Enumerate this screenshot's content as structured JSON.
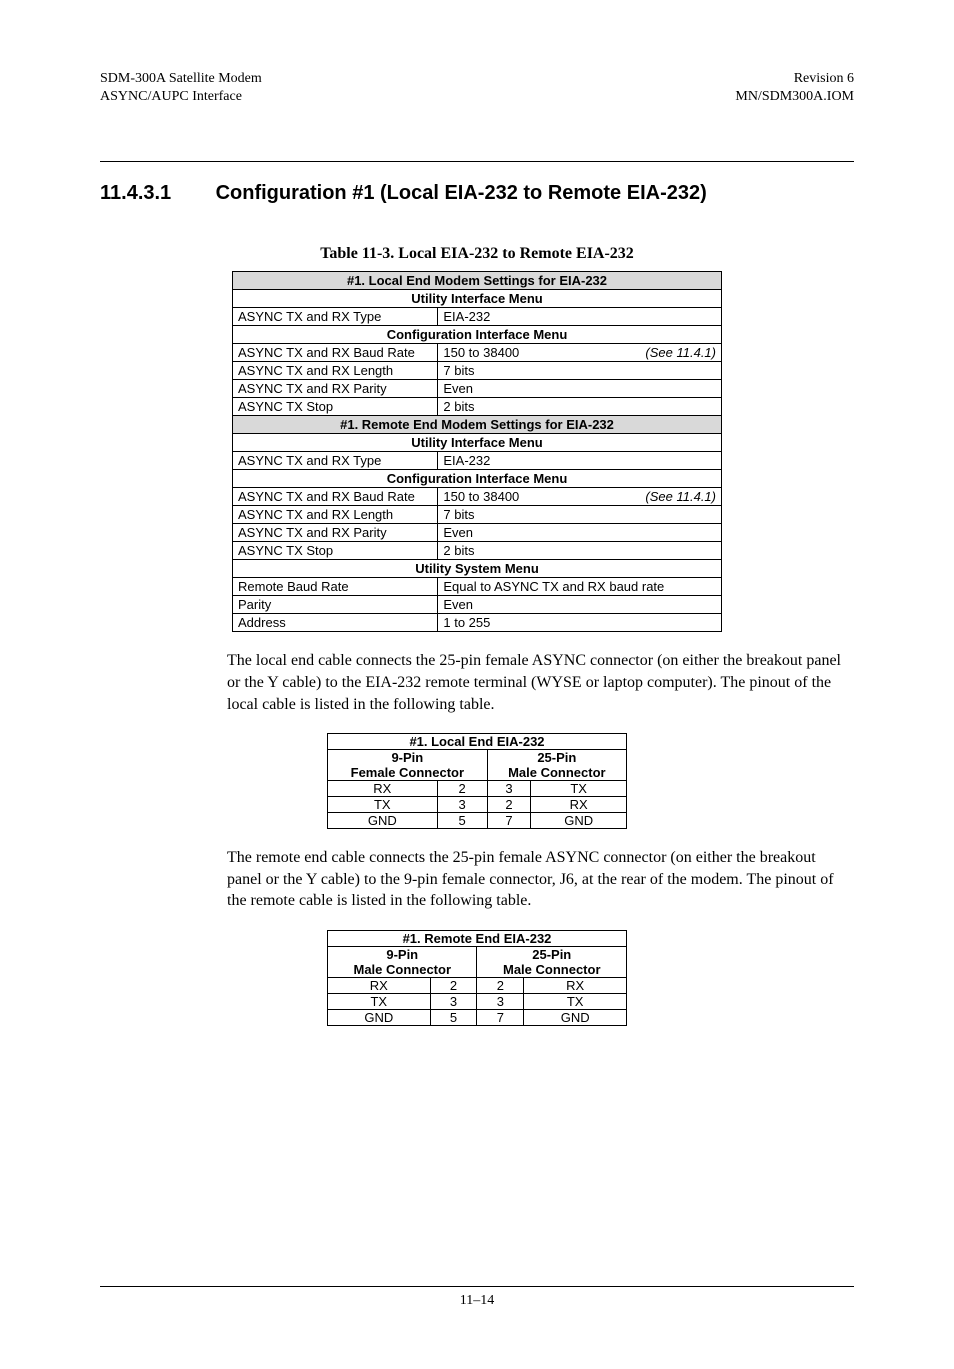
{
  "header": {
    "left1": "SDM-300A Satellite Modem",
    "left2": "ASYNC/AUPC Interface",
    "right1": "Revision 6",
    "right2": "MN/SDM300A.IOM"
  },
  "section": {
    "number": "11.4.3.1",
    "title": "Configuration #1 (Local EIA-232 to Remote EIA-232)"
  },
  "table_caption": "Table 11-3.  Local EIA-232 to Remote EIA-232",
  "settings_table": {
    "title1": "#1. Local End Modem Settings for EIA-232",
    "menu_util": "Utility Interface Menu",
    "row_type_label": "ASYNC TX and RX Type",
    "row_type_val": "EIA-232",
    "menu_conf": "Configuration Interface Menu",
    "row_baud_label": "ASYNC TX and RX Baud Rate",
    "row_baud_val": "150 to 38400",
    "row_baud_note": "(See 11.4.1)",
    "row_len_label": "ASYNC TX and RX Length",
    "row_len_val": "7 bits",
    "row_par_label": "ASYNC TX and RX Parity",
    "row_par_val": "Even",
    "row_stop_label": "ASYNC TX Stop",
    "row_stop_val": "2 bits",
    "title2": "#1. Remote End Modem Settings for EIA-232",
    "menu_sys": "Utility System Menu",
    "row_rbaud_label": "Remote Baud Rate",
    "row_rbaud_val": "Equal to ASYNC TX and RX baud rate",
    "row_rpar_label": "Parity",
    "row_rpar_val": "Even",
    "row_addr_label": "Address",
    "row_addr_val": "1 to 255"
  },
  "para1": "The local end cable connects the 25-pin female ASYNC connector (on either the breakout panel or the Y cable) to the EIA-232 remote terminal (WYSE or laptop computer). The pinout of the local cable is listed in the following table.",
  "pinout1": {
    "title": "#1. Local End EIA-232",
    "left_h1": "9-Pin",
    "left_h2": "Female Connector",
    "right_h1": "25-Pin",
    "right_h2": "Male Connector",
    "rows": [
      [
        "RX",
        "2",
        "3",
        "TX"
      ],
      [
        "TX",
        "3",
        "2",
        "RX"
      ],
      [
        "GND",
        "5",
        "7",
        "GND"
      ]
    ]
  },
  "para2": "The remote end cable connects the 25-pin female ASYNC connector (on either the breakout panel or the Y cable) to the 9-pin female connector, J6, at the rear of the modem. The pinout of the remote cable is listed in the following table.",
  "pinout2": {
    "title": "#1. Remote End EIA-232",
    "left_h1": "9-Pin",
    "left_h2": "Male Connector",
    "right_h1": "25-Pin",
    "right_h2": "Male Connector",
    "rows": [
      [
        "RX",
        "2",
        "2",
        "RX"
      ],
      [
        "TX",
        "3",
        "3",
        "TX"
      ],
      [
        "GND",
        "5",
        "7",
        "GND"
      ]
    ]
  },
  "page_number": "11–14"
}
